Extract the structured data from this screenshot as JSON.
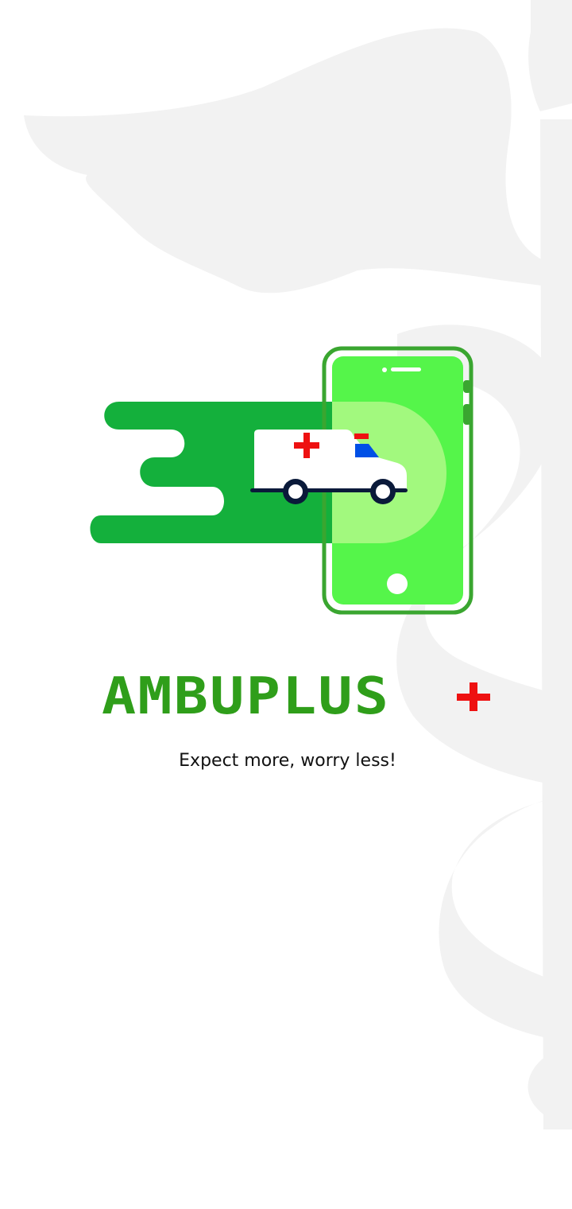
{
  "app": {
    "name": "AMBUPLUS",
    "tagline": "Expect more, worry less!"
  },
  "icons": {
    "watermark": "caduceus-icon",
    "hero": "phone-ambulance-illustration",
    "plus": "red-plus-icon"
  },
  "colors": {
    "brand_green": "#2f9e1a",
    "speed_green": "#14b03c",
    "phone_green": "#55f54a",
    "phone_border": "#3aa630",
    "plus_red": "#ee1111",
    "watermark_grey": "#f2f2f2"
  }
}
